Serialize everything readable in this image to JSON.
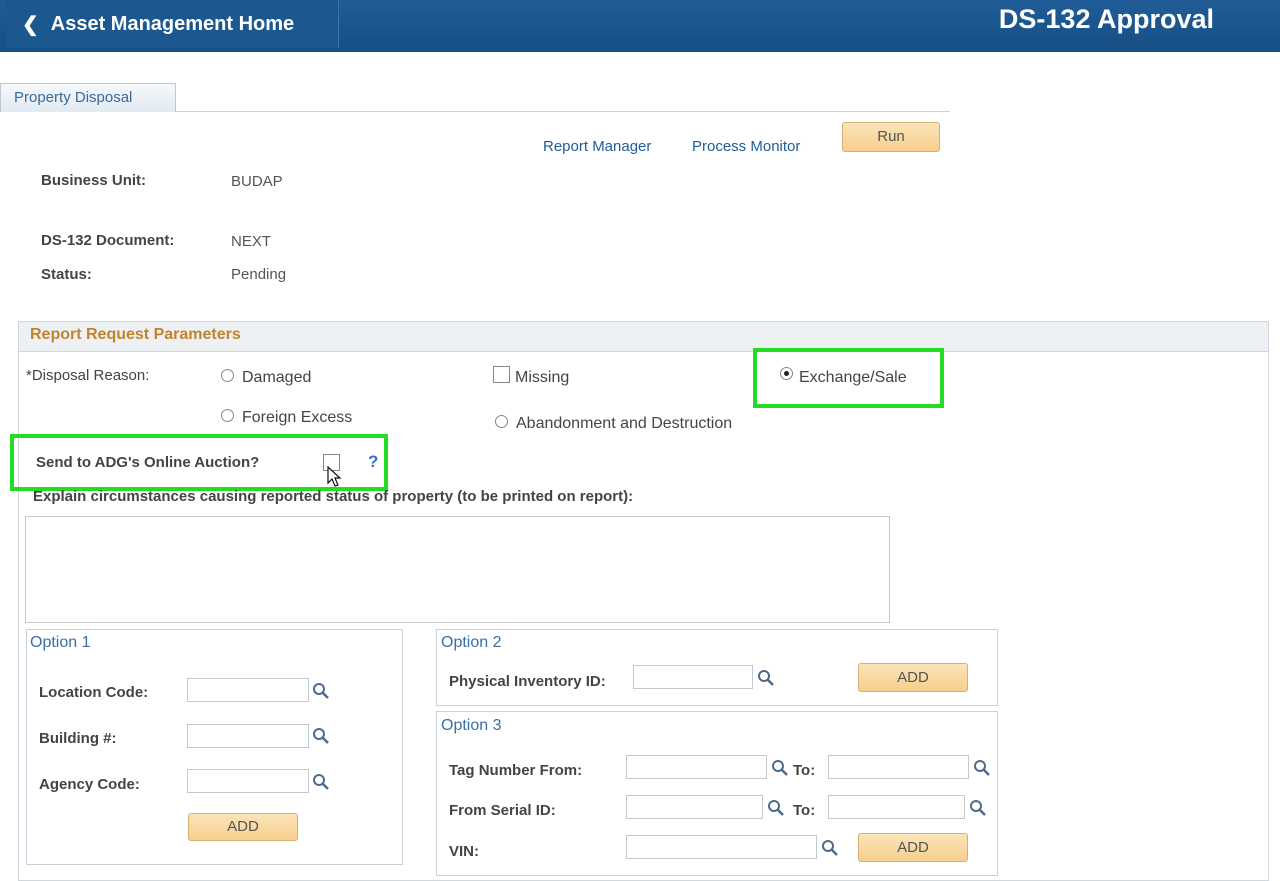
{
  "header": {
    "back_label": "Asset Management Home",
    "title": "DS-132 Approval"
  },
  "tab": {
    "label": "Property Disposal"
  },
  "links": {
    "report_manager": "Report Manager",
    "process_monitor": "Process Monitor"
  },
  "run_label": "Run",
  "fields": {
    "business_unit_label": "Business Unit:",
    "business_unit_value": "BUDAP",
    "document_label": "DS-132 Document:",
    "document_value": "NEXT",
    "status_label": "Status:",
    "status_value": "Pending"
  },
  "params": {
    "title": "Report Request Parameters",
    "reason_label": "*Disposal Reason:",
    "reasons": {
      "damaged": "Damaged",
      "missing": "Missing",
      "exchange": "Exchange/Sale",
      "foreign": "Foreign Excess",
      "abandon": "Abandonment and Destruction"
    },
    "selected_reason": "Exchange/Sale",
    "auction_label": "Send to ADG's Online Auction?",
    "help": "?",
    "explain_label": "Explain circumstances causing reported status of property (to be printed on report):",
    "explain_value": ""
  },
  "option1": {
    "title": "Option 1",
    "location_label": "Location Code:",
    "building_label": "Building #:",
    "agency_label": "Agency Code:",
    "add": "ADD"
  },
  "option2": {
    "title": "Option 2",
    "inventory_label": "Physical Inventory ID:",
    "add": "ADD"
  },
  "option3": {
    "title": "Option 3",
    "tag_label": "Tag Number From:",
    "serial_label": "From Serial ID:",
    "vin_label": "VIN:",
    "to_label": "To:",
    "add": "ADD"
  },
  "colors": {
    "header": "#1f5c96",
    "highlight": "#22dd22",
    "section_title": "#c4822a"
  },
  "icons": {
    "lookup": "magnifier-icon",
    "back": "chevron-left-icon"
  }
}
